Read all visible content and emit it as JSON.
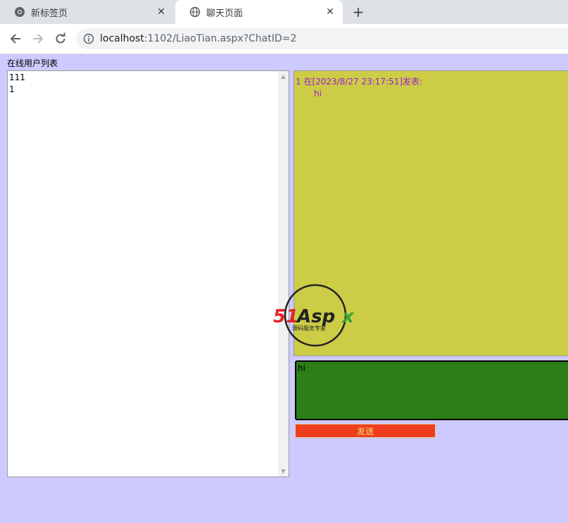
{
  "browser": {
    "tabs": [
      {
        "title": "新标签页",
        "active": false
      },
      {
        "title": "聊天页面",
        "active": true
      }
    ],
    "url": {
      "host": "localhost",
      "path": ":1102/LiaoTian.aspx?ChatID=2"
    }
  },
  "page": {
    "userlist_label": "在线用户列表",
    "users": [
      "111",
      "1"
    ],
    "messages": [
      {
        "header": "1 在[2023/8/27 23:17:51]发表:",
        "body": "hi"
      }
    ],
    "input_value": "hi",
    "send_label": "发送",
    "watermark": {
      "brand": "51Aspx",
      "tagline": "源码服务专家"
    }
  },
  "colors": {
    "background": "#cdcaff",
    "message_panel": "#cccc47",
    "message_text": "#9b1dd1",
    "input_bg": "#2d7d18",
    "send_bg": "#ee3e1f",
    "send_text": "#f4e26a"
  }
}
